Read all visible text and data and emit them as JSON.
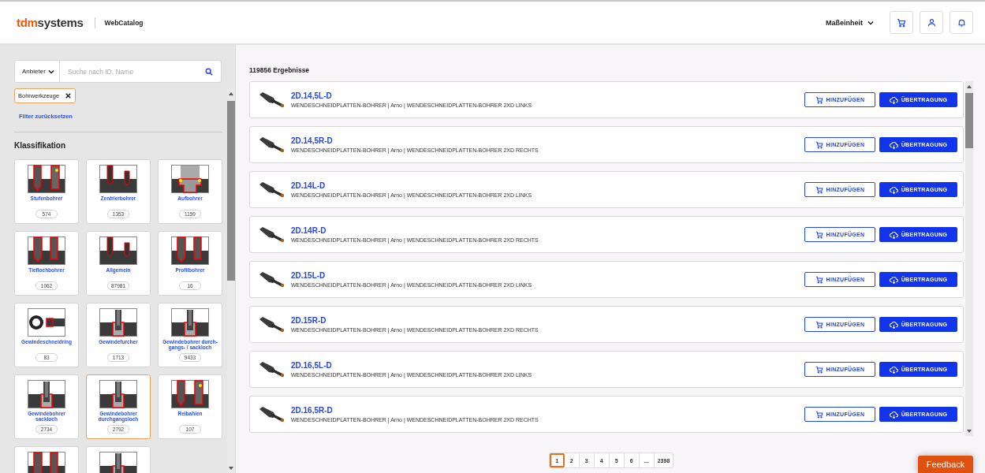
{
  "header": {
    "logo": {
      "part_1": "tdm",
      "part_2": "systems"
    },
    "app_name": "WebCatalog",
    "unit_menu": "Maßeinheit"
  },
  "search": {
    "provider_menu": "Anbieter",
    "placeholder": "Suche nach ID, Name"
  },
  "active_filters": [
    {
      "label": "Bohrwerkzeuge"
    }
  ],
  "reset_filters": "Filter zurücksetzen",
  "classification": {
    "title": "Klassifikation",
    "categories": [
      {
        "name": "Stufenbohrer",
        "count": "574",
        "selected": false,
        "kind": "step"
      },
      {
        "name": "Zentrierbohrer",
        "count": "1353",
        "selected": false,
        "kind": "center"
      },
      {
        "name": "Aufbohrer",
        "count": "1159",
        "selected": false,
        "kind": "bore"
      },
      {
        "name": "Tieflochbohrer",
        "count": "1062",
        "selected": false,
        "kind": "deep"
      },
      {
        "name": "Allgemein",
        "count": "87981",
        "selected": false,
        "kind": "center"
      },
      {
        "name": "Profilbohrer",
        "count": "16",
        "selected": false,
        "kind": "deep"
      },
      {
        "name": "Gewindeschneidring",
        "count": "83",
        "selected": false,
        "kind": "ring"
      },
      {
        "name": "Gewindefurcher",
        "count": "1713",
        "selected": false,
        "kind": "tap"
      },
      {
        "name": "Gewindebohrer durch-gangs- / sackloch",
        "count": "9433",
        "selected": false,
        "kind": "tap"
      },
      {
        "name": "Gewindebohrer sackloch",
        "count": "2734",
        "selected": false,
        "kind": "tap"
      },
      {
        "name": "Gewindebohrer durchgangsloch",
        "count": "2792",
        "selected": true,
        "kind": "tap"
      },
      {
        "name": "Reibahlen",
        "count": "107",
        "selected": false,
        "kind": "step"
      },
      {
        "selected": false,
        "kind": "deep"
      },
      {
        "selected": false,
        "kind": "tap"
      }
    ]
  },
  "results": {
    "count_label": "119856 Ergebnisse",
    "items": [
      {
        "code": "2D.14,5L-D",
        "description": "WENDESCHNEIDPLATTEN-BOHRER | Arno | WENDESCHNEIDPLATTEN-BOHRER 2XD LINKS",
        "add_label": "HINZUFÜGEN",
        "transfer_label": "ÜBERTRAGUNG"
      },
      {
        "code": "2D.14,5R-D",
        "description": "WENDESCHNEIDPLATTEN-BOHRER | Arno | WENDESCHNEIDPLATTEN-BOHRER 2XD RECHTS",
        "add_label": "HINZUFÜGEN",
        "transfer_label": "ÜBERTRAGUNG"
      },
      {
        "code": "2D.14L-D",
        "description": "WENDESCHNEIDPLATTEN-BOHRER | Arno | WENDESCHNEIDPLATTEN-BOHRER 2XD LINKS",
        "add_label": "HINZUFÜGEN",
        "transfer_label": "ÜBERTRAGUNG"
      },
      {
        "code": "2D.14R-D",
        "description": "WENDESCHNEIDPLATTEN-BOHRER | Arno | WENDESCHNEIDPLATTEN-BOHRER 2XD RECHTS",
        "add_label": "HINZUFÜGEN",
        "transfer_label": "ÜBERTRAGUNG"
      },
      {
        "code": "2D.15L-D",
        "description": "WENDESCHNEIDPLATTEN-BOHRER | Arno | WENDESCHNEIDPLATTEN-BOHRER 2XD LINKS",
        "add_label": "HINZUFÜGEN",
        "transfer_label": "ÜBERTRAGUNG"
      },
      {
        "code": "2D.15R-D",
        "description": "WENDESCHNEIDPLATTEN-BOHRER | Arno | WENDESCHNEIDPLATTEN-BOHRER 2XD RECHTS",
        "add_label": "HINZUFÜGEN",
        "transfer_label": "ÜBERTRAGUNG"
      },
      {
        "code": "2D.16,5L-D",
        "description": "WENDESCHNEIDPLATTEN-BOHRER | Arno | WENDESCHNEIDPLATTEN-BOHRER 2XD LINKS",
        "add_label": "HINZUFÜGEN",
        "transfer_label": "ÜBERTRAGUNG"
      },
      {
        "code": "2D.16,5R-D",
        "description": "WENDESCHNEIDPLATTEN-BOHRER | Arno | WENDESCHNEIDPLATTEN-BOHRER 2XD RECHTS",
        "add_label": "HINZUFÜGEN",
        "transfer_label": "ÜBERTRAGUNG"
      }
    ]
  },
  "pagination": [
    {
      "label": "1",
      "selected": true
    },
    {
      "label": "2",
      "selected": false
    },
    {
      "label": "3",
      "selected": false
    },
    {
      "label": "4",
      "selected": false
    },
    {
      "label": "5",
      "selected": false
    },
    {
      "label": "6",
      "selected": false
    },
    {
      "label": "...",
      "selected": false
    },
    {
      "label": "2398",
      "selected": false
    }
  ],
  "feedback_button": "Feedback"
}
